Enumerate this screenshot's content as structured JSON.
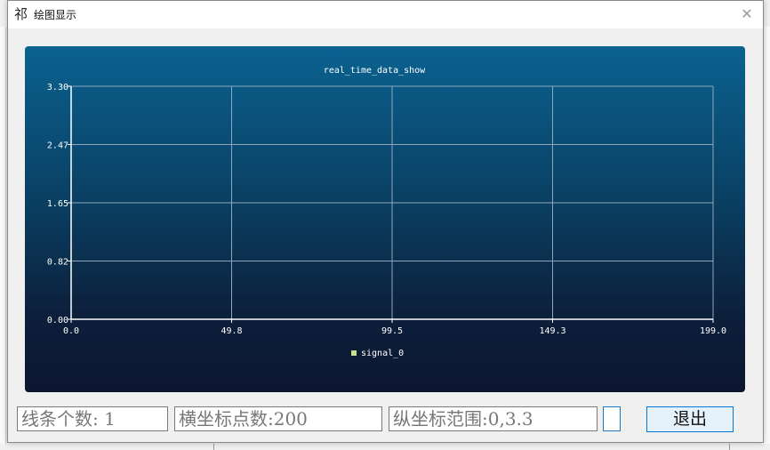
{
  "dialog": {
    "icon_glyph": "祁",
    "title": "绘图显示",
    "close_glyph": "✕"
  },
  "chart_data": {
    "type": "line",
    "title": "real_time_data_show",
    "xlabel": "",
    "ylabel": "",
    "x_ticks": [
      "0.0",
      "49.8",
      "99.5",
      "149.3",
      "199.0"
    ],
    "y_ticks": [
      "0.00",
      "0.82",
      "1.65",
      "2.47",
      "3.30"
    ],
    "xlim": [
      0,
      199
    ],
    "ylim": [
      0,
      3.3
    ],
    "grid": true,
    "legend_position": "bottom-center",
    "series": [
      {
        "name": "signal_0",
        "color": "#c8e08a",
        "x": [],
        "y": []
      }
    ],
    "colors": {
      "background_top": "#0a6290",
      "background_bottom": "#0d1630",
      "axis": "#ffffff",
      "grid": "#8fa7bd",
      "text": "#ffffff"
    }
  },
  "controls": {
    "line_count": "线条个数: 1",
    "x_points": "横坐标点数:200",
    "y_range": "纵坐标范围:0,3.3",
    "exit_label": "退出"
  }
}
